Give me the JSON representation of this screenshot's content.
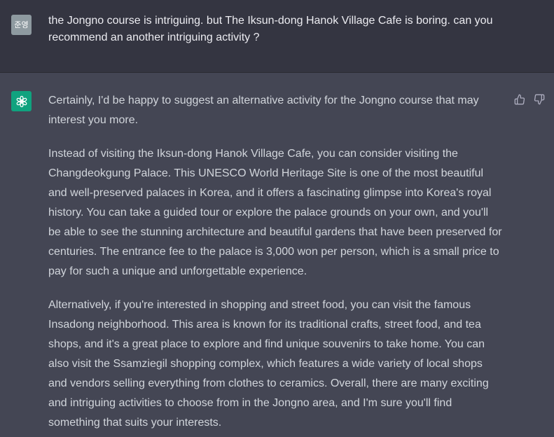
{
  "user_message": {
    "avatar_text": "준영",
    "text": "the Jongno course is intriguing. but The Iksun-dong Hanok Village Cafe is boring. can you recommend an another intriguing activity ?"
  },
  "assistant_message": {
    "avatar_icon": "openai-logo-icon",
    "paragraphs": [
      "Certainly, I'd be happy to suggest an alternative activity for the Jongno course that may interest you more.",
      "Instead of visiting the Iksun-dong Hanok Village Cafe, you can consider visiting the Changdeokgung Palace. This UNESCO World Heritage Site is one of the most beautiful and well-preserved palaces in Korea, and it offers a fascinating glimpse into Korea's royal history. You can take a guided tour or explore the palace grounds on your own, and you'll be able to see the stunning architecture and beautiful gardens that have been preserved for centuries. The entrance fee to the palace is 3,000 won per person, which is a small price to pay for such a unique and unforgettable experience.",
      "Alternatively, if you're interested in shopping and street food, you can visit the famous Insadong neighborhood. This area is known for its traditional crafts, street food, and tea shops, and it's a great place to explore and find unique souvenirs to take home. You can also visit the Ssamziegil shopping complex, which features a wide variety of local shops and vendors selling everything from clothes to ceramics. Overall, there are many exciting and intriguing activities to choose from in the Jongno area, and I'm sure you'll find something that suits your interests."
    ],
    "feedback_icons": [
      "thumbs-up-icon",
      "thumbs-down-icon"
    ]
  },
  "colors": {
    "user_bg": "#343541",
    "assistant_bg": "#444654",
    "user_avatar_bg": "#8e9aa0",
    "assistant_avatar_bg": "#10a37f",
    "text": "#d1d5db"
  }
}
